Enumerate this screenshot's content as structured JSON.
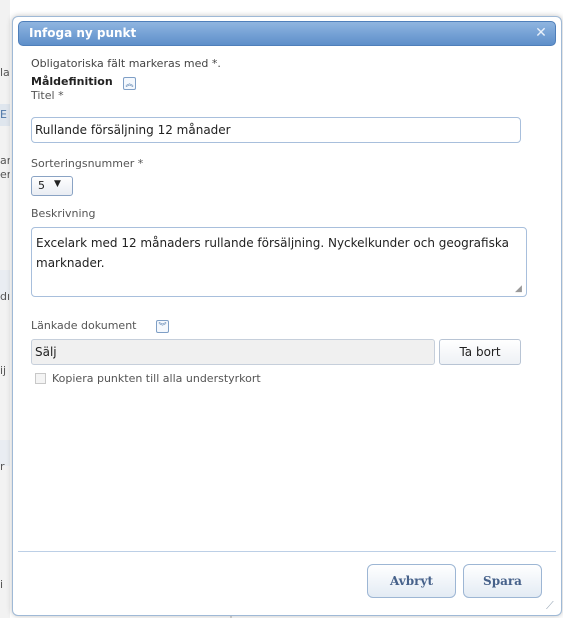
{
  "background": {
    "fragments": [
      "la",
      "E",
      "ar",
      "er",
      "dı",
      "ij",
      "r",
      "i"
    ]
  },
  "dialog": {
    "title": "Infoga ny punkt",
    "close_icon": "close-icon",
    "required_note": "Obligatoriska fält markeras med *.",
    "section_heading": "Måldefinition",
    "section_toggle_icon": "collapse-up-icon",
    "title_label": "Titel *",
    "title_value": "Rullande försäljning 12 månader",
    "sort_label": "Sorteringsnummer *",
    "sort_value": "5",
    "description_label": "Beskrivning",
    "description_value": "Excelark med 12 månaders rullande försäljning. Nyckelkunder och geografiska marknader.",
    "linked_docs_label": "Länkade dokument",
    "linked_docs_toggle_icon": "expand-down-icon",
    "linked_doc_value": "Sälj",
    "remove_button": "Ta bort",
    "copy_checkbox_label": "Kopiera punkten till alla understyrkort",
    "copy_checked": false,
    "cancel_button": "Avbryt",
    "save_button": "Spara"
  },
  "colors": {
    "title_bar": "#5e8fca",
    "button_text": "#46618a",
    "input_border": "#a8bfdc"
  }
}
